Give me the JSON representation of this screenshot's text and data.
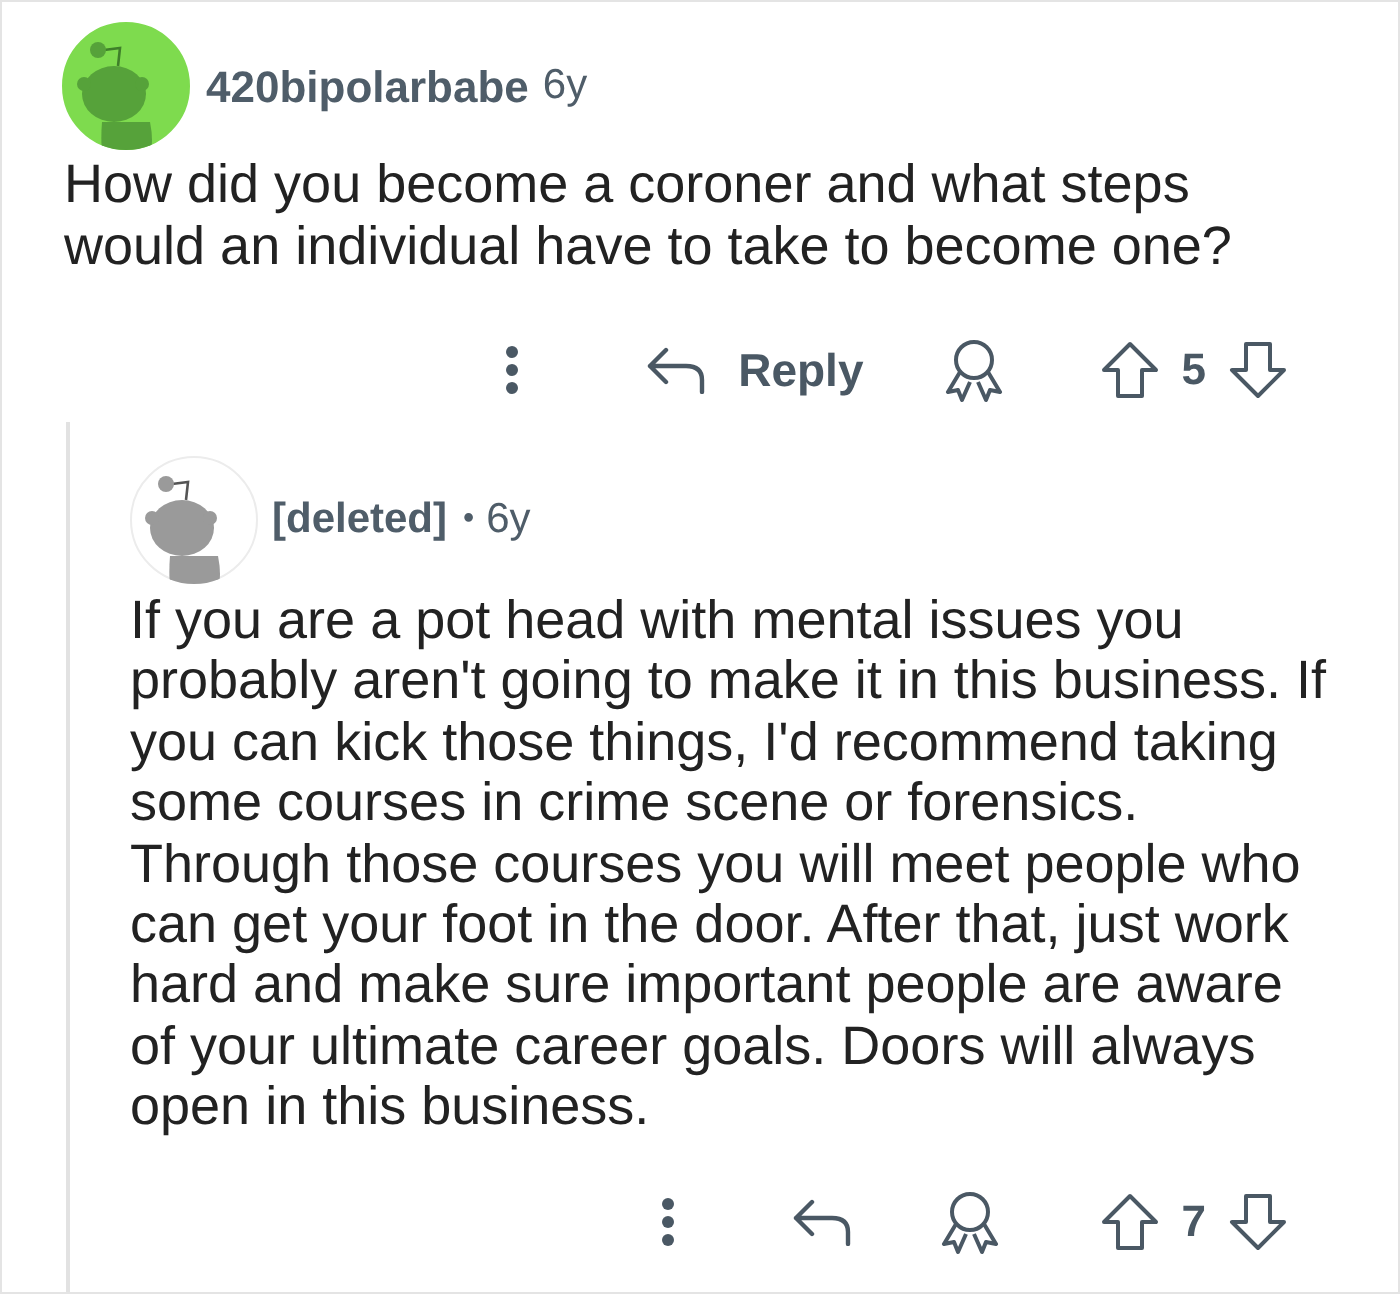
{
  "comment": {
    "author": "420bipolarbabe",
    "age": "6y",
    "body": "How did you become a coroner and what steps would an individual have to take to become one?",
    "actions": {
      "reply_label": "Reply",
      "score": "5"
    }
  },
  "reply": {
    "author": "[deleted]",
    "separator": "•",
    "age": "6y",
    "body": "If you are a pot head with mental issues you probably aren't going to make it in this business. If you can kick those things, I'd recommend taking some courses in crime scene or forensics.\nThrough those courses you will meet people who can get your foot in the door. After that, just work hard and make sure important people are aware of your ultimate career goals. Doors will always open in this business.",
    "actions": {
      "score": "7"
    }
  }
}
